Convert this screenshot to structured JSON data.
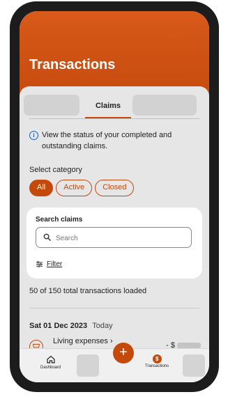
{
  "header": {
    "title": "Transactions"
  },
  "tabs": [
    {
      "label": ""
    },
    {
      "label": "Claims"
    },
    {
      "label": ""
    }
  ],
  "info": {
    "text": "View the status of your completed and outstanding claims."
  },
  "category": {
    "label": "Select category",
    "options": [
      "All",
      "Active",
      "Closed"
    ],
    "selected": "All"
  },
  "search": {
    "label": "Search claims",
    "placeholder": "Search",
    "value": "",
    "filter_label": "Filter"
  },
  "summary": {
    "loaded_text": "50 of 150 total transactions loaded"
  },
  "group": {
    "date": "Sat 01 Dec 2023",
    "relative": "Today"
  },
  "transaction": {
    "title": "Living expenses",
    "chevron": "›",
    "amount_prefix": "- $"
  },
  "fab": {
    "symbol": "+"
  },
  "bottom_nav": {
    "items": [
      {
        "label": "Dashboard",
        "icon": "home-icon"
      },
      {
        "label": "",
        "icon": "placeholder"
      },
      {
        "label": "Transactions",
        "icon": "dollar-circle-icon",
        "badge": "$"
      },
      {
        "label": "",
        "icon": "placeholder"
      }
    ]
  },
  "colors": {
    "accent": "#c44a0c",
    "header": "#d95a1a",
    "info_icon": "#1a5fb4",
    "background": "#e6e6e6"
  }
}
